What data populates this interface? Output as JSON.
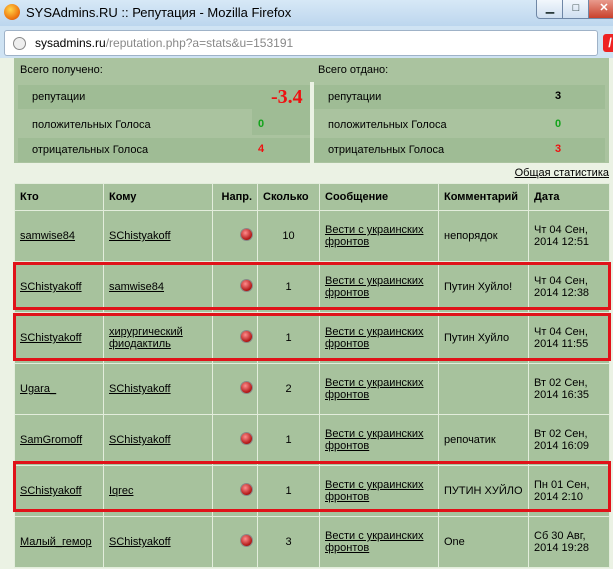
{
  "window": {
    "title": "SYSAdmins.RU :: Репутация - Mozilla Firefox"
  },
  "urlbar": {
    "domain": "sysadmins.ru",
    "path": "/reputation.php?a=stats&u=153191"
  },
  "stats": {
    "received": {
      "header": "Всего получено:",
      "reputation_label": "репутации",
      "reputation_value": "-3.4",
      "positive_label": "положительных Голоса",
      "positive_value": "0",
      "negative_label": "отрицательных Голоса",
      "negative_value": "4"
    },
    "given": {
      "header": "Всего отдано:",
      "reputation_label": "репутации",
      "reputation_value": "3",
      "positive_label": "положительных Голоса",
      "positive_value": "0",
      "negative_label": "отрицательных Голоса",
      "negative_value": "3"
    },
    "general_link": "Общая статистика"
  },
  "table": {
    "headers": [
      "Кто",
      "Кому",
      "Напр.",
      "Сколько",
      "Сообщение",
      "Комментарий",
      "Дата"
    ],
    "rows": [
      {
        "from": "samwise84",
        "to": "SChistyakoff",
        "amount": "10",
        "message": "Вести с украинских фронтов",
        "comment": "непорядок",
        "date": "Чт 04 Сен, 2014 12:51"
      },
      {
        "from": "SChistyakoff",
        "to": "samwise84",
        "amount": "1",
        "message": "Вести с украинских фронтов",
        "comment": "Путин Хуйло!",
        "date": "Чт 04 Сен, 2014 12:38"
      },
      {
        "from": "SChistyakoff",
        "to": "хирургический фиодактиль",
        "amount": "1",
        "message": "Вести с украинских фронтов",
        "comment": "Путин Хуйло",
        "date": "Чт 04 Сен, 2014 11:55"
      },
      {
        "from": "Ugara_",
        "to": "SChistyakoff",
        "amount": "2",
        "message": "Вести с украинских фронтов",
        "comment": "",
        "date": "Вт 02 Сен, 2014 16:35"
      },
      {
        "from": "SamGromoff",
        "to": "SChistyakoff",
        "amount": "1",
        "message": "Вести с украинских фронтов",
        "comment": "репочатик",
        "date": "Вт 02 Сен, 2014 16:09"
      },
      {
        "from": "SChistyakoff",
        "to": "Iqrec",
        "amount": "1",
        "message": "Вести с украинских фронтов",
        "comment": "ПУТИН ХУЙЛО",
        "date": "Пн 01 Сен, 2014 2:10"
      },
      {
        "from": "Малый_гемор",
        "to": "SChistyakoff",
        "amount": "3",
        "message": "Вести с украинских фронтов",
        "comment": "One",
        "date": "Сб 30 Авг, 2014 19:28"
      }
    ]
  },
  "highlight_color": "#e01219"
}
